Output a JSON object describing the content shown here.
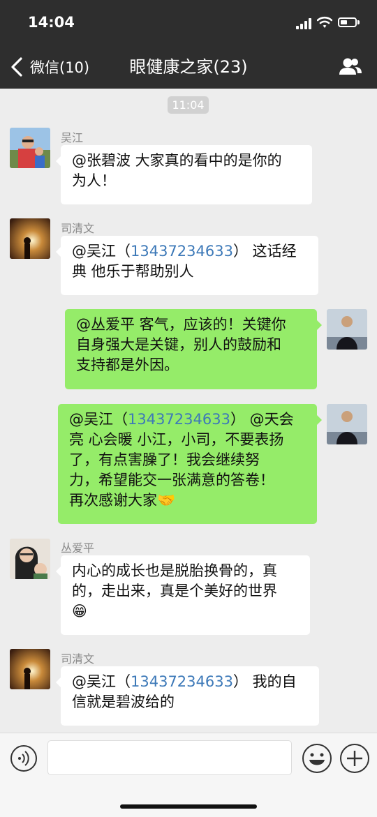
{
  "status_bar": {
    "time": "14:04"
  },
  "nav": {
    "back_label": "微信(10)",
    "title": "眼健康之家(23)"
  },
  "time_divider": "11:04",
  "messages": [
    {
      "sender": "吴江",
      "text": "@张碧波 大家真的看中的是你的\n为人！"
    },
    {
      "sender": "司清文",
      "pre": "@吴江（",
      "phone": "13437234633",
      "post": "） 这话经\n典 他乐于帮助别人"
    },
    {
      "text": "@丛爱平 客气，应该的！关键你\n自身强大是关键，别人的鼓励和\n支持都是外因。"
    },
    {
      "pre": "@吴江（",
      "phone": "13437234633",
      "post": "） @天会\n亮 心会暖 小江，小司，不要表扬\n了，有点害臊了！我会继续努\n力，希望能交一张满意的答卷！\n再次感谢大家🤝"
    },
    {
      "sender": "丛爱平",
      "text": "内心的成长也是脱胎换骨的，真\n的，走出来，真是个美好的世界\n😁"
    },
    {
      "sender": "司清文",
      "pre": "@吴江（",
      "phone": "13437234633",
      "post": "） 我的自\n信就是碧波给的"
    }
  ],
  "colors": {
    "header": "#2e2e2e",
    "bubble_out": "#95ec69",
    "bubble_in": "#ffffff",
    "link": "#3d79b8",
    "background": "#ededed"
  },
  "icons": [
    "back-chevron-icon",
    "group-members-icon",
    "voice-icon",
    "emoji-icon",
    "plus-icon"
  ]
}
